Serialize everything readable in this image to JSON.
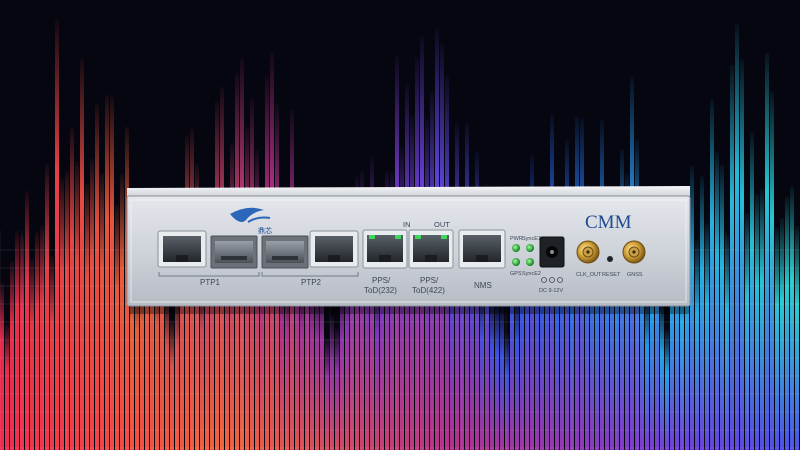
{
  "device": {
    "model": "CMM",
    "logo_text": "鼎芯",
    "group_labels": {
      "ptp1": "PTP1",
      "ptp2": "PTP2"
    },
    "port_labels": {
      "in": "IN",
      "out": "OUT",
      "pps_232_a": "PPS/",
      "pps_232_b": "ToD(232)",
      "pps_422_a": "PPS/",
      "pps_422_b": "ToD(422)",
      "nms": "NMS"
    },
    "led_labels": {
      "pwr": "PWR",
      "sync_e1": "SyncE1",
      "gps": "GPS",
      "sync_e2": "SyncE2"
    },
    "power_label": "DC 9-12V",
    "clk_out": "CLK_OUT",
    "reset": "RESET",
    "gnss": "GNSS"
  },
  "background": {
    "colors": [
      "#ff2d55",
      "#ff6a3d",
      "#c2338f",
      "#7b3fe0",
      "#2f63ff",
      "#25b7ff",
      "#2ee6e0"
    ]
  }
}
